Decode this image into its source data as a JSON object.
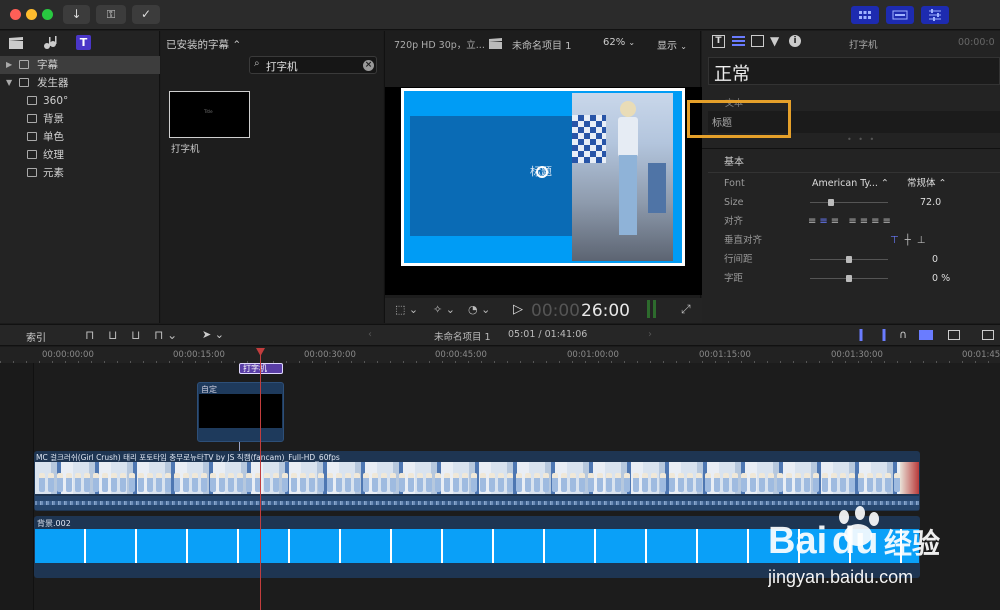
{
  "top_bar": {
    "import_icon": "download-arrow",
    "keywords_icon": "key",
    "check_icon": "checkmark"
  },
  "sidebar": {
    "items": [
      {
        "label": "字幕",
        "level": 0,
        "selected": true
      },
      {
        "label": "发生器",
        "level": 0,
        "selected": false
      },
      {
        "label": "360°",
        "level": 1,
        "selected": false
      },
      {
        "label": "背景",
        "level": 1,
        "selected": false
      },
      {
        "label": "单色",
        "level": 1,
        "selected": false
      },
      {
        "label": "纹理",
        "level": 1,
        "selected": false
      },
      {
        "label": "元素",
        "level": 1,
        "selected": false
      }
    ]
  },
  "browser": {
    "filter_label": "已安装的字幕 ⌃",
    "search_value": "打字机",
    "thumb_text": "Title",
    "clip_name": "打字机"
  },
  "viewer": {
    "format": "720p HD 30p，立...",
    "project": "未命名项目 1",
    "zoom": "62%",
    "view_menu": "显示",
    "canvas_title": "标题",
    "timecode_dim": "00:00",
    "timecode": "26:00"
  },
  "inspector": {
    "title": "打字机",
    "time": "00:00:0",
    "preset": "正常",
    "text_section": "文本",
    "text_value": "标题",
    "basic_section": "基本",
    "rows": [
      {
        "key": "Font",
        "value": "American Ty... ⌃",
        "value2": "常规体 ⌃"
      },
      {
        "key": "Size",
        "value": "72.0"
      },
      {
        "key": "对齐",
        "value": ""
      },
      {
        "key": "垂直对齐",
        "value": ""
      },
      {
        "key": "行间距",
        "value": "0"
      },
      {
        "key": "字距",
        "value": "0 %"
      }
    ]
  },
  "timeline": {
    "index_label": "索引",
    "project": "未命名项目 1",
    "position": "05:01 / 01:41:06",
    "ruler_labels": [
      "00:00:00:00",
      "00:00:15:00",
      "00:00:30:00",
      "00:00:45:00",
      "00:01:00:00",
      "00:01:15:00",
      "00:01:30:00",
      "00:01:45"
    ],
    "title_clip": "打字机",
    "connected_clip": "自定",
    "video_clip": "MC 걸크러쉬(Girl Crush) 태리 포토타임 충무로뉴타TV by JS 직캠(fancam)_Full-HD_60fps",
    "bg_clip": "背景.002"
  },
  "colors": {
    "accent_blue": "#00a0ff",
    "highlight_orange": "#e5a02a",
    "title_purple": "#5a3ea6",
    "selected_row": "#3d3d3d"
  }
}
